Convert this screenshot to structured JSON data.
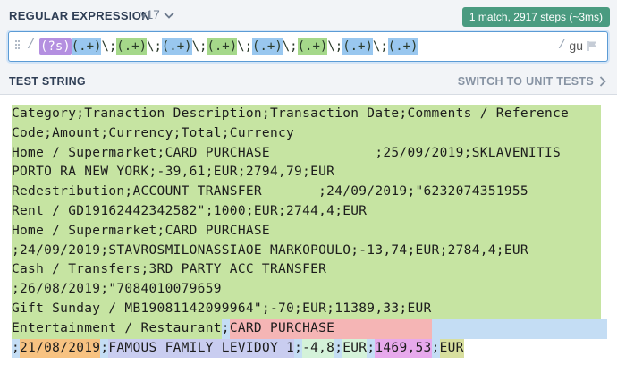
{
  "regex_panel": {
    "title": "REGULAR EXPRESSION",
    "flavor": "v17",
    "match_info": "1 match, 2917 steps (~3ms)",
    "delimiter_left": "/",
    "delimiter_right": "/",
    "flags": "gu",
    "tokens": [
      {
        "text": "(?s)",
        "kind": "flag"
      },
      {
        "text": "(.+)",
        "kind": "groupb"
      },
      {
        "text": "\\;",
        "kind": "esc"
      },
      {
        "text": "(.+)",
        "kind": "group"
      },
      {
        "text": "\\;",
        "kind": "esc"
      },
      {
        "text": "(.+)",
        "kind": "groupb"
      },
      {
        "text": "\\;",
        "kind": "esc"
      },
      {
        "text": "(.+)",
        "kind": "group"
      },
      {
        "text": "\\;",
        "kind": "esc"
      },
      {
        "text": "(.+)",
        "kind": "groupb"
      },
      {
        "text": "\\;",
        "kind": "esc"
      },
      {
        "text": "(.+)",
        "kind": "group"
      },
      {
        "text": "\\;",
        "kind": "esc"
      },
      {
        "text": "(.+)",
        "kind": "groupb"
      },
      {
        "text": "\\;",
        "kind": "esc"
      },
      {
        "text": "(.+)",
        "kind": "groupb"
      }
    ]
  },
  "test_panel": {
    "title": "TEST STRING",
    "switch_label": "SWITCH TO UNIT TESTS",
    "lines": [
      "Category;Tranaction Description;Transaction Date;Comments / Reference",
      "Code;Amount;Currency;Total;Currency",
      "Home / Supermarket;CARD PURCHASE             ;25/09/2019;SKLAVENITIS",
      "PORTO RA NEW YORK;-39,61;EUR;2794,79;EUR",
      "Redestribution;ACCOUNT TRANSFER       ;24/09/2019;\"6232074351955",
      "Rent / GD19162442342582\";1000;EUR;2744,4;EUR",
      "Home / Supermarket;CARD PURCHASE",
      ";24/09/2019;STAVROSMILONASSIAOE MARKOPOULO;-13,74;EUR;2784,4;EUR",
      "Cash / Transfers;3RD PARTY ACC TRANSFER",
      ";26/08/2019;\"7084010079659",
      "Gift Sunday / MB19081142099964\";-70;EUR;11389,33;EUR"
    ],
    "line12_segments": [
      {
        "text": "Entertainment / Restaurant",
        "color": "green"
      },
      {
        "text": ";",
        "color": "blue"
      },
      {
        "text": "CARD PURCHASE            ",
        "color": "red"
      },
      {
        "text": "",
        "color": "blue"
      }
    ],
    "line13_segments": [
      {
        "text": ";",
        "color": "blue"
      },
      {
        "text": "21/08/2019",
        "color": "orange"
      },
      {
        "text": ";",
        "color": "blue"
      },
      {
        "text": "FAMOUS FAMILY LEVIDOY 1",
        "color": "lav"
      },
      {
        "text": ";",
        "color": "blue"
      },
      {
        "text": "-4,8",
        "color": "mint"
      },
      {
        "text": ";",
        "color": "blue"
      },
      {
        "text": "EUR",
        "color": "mint"
      },
      {
        "text": ";",
        "color": "blue"
      },
      {
        "text": "1469,53",
        "color": "pink"
      },
      {
        "text": ";",
        "color": "blue"
      },
      {
        "text": "EUR",
        "color": "olive"
      }
    ]
  },
  "colors": {
    "match_green": "#c6e4a2",
    "match_blue": "#c4ddf4",
    "group_red": "#f5b5b5",
    "accent_badge": "#4a9b80",
    "regex_border": "#5b9bd5"
  },
  "icons": {
    "flavor_dropdown": "chevron-down-icon",
    "switch_arrow": "chevron-right-icon",
    "flags_flag": "flag-icon",
    "drag_handle": "drag-handle-icon"
  }
}
